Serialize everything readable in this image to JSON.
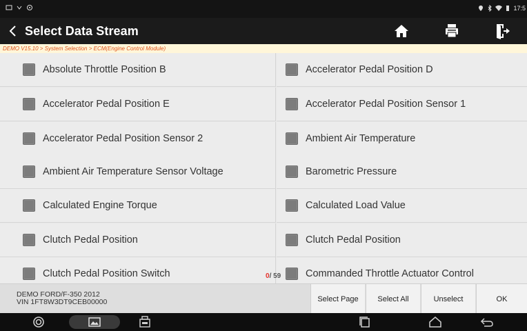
{
  "status_bar": {
    "time": "17:5"
  },
  "header": {
    "title": "Select Data Stream",
    "back_icon": "chevron-left-icon",
    "actions": [
      "home-icon",
      "printer-icon",
      "exit-icon"
    ]
  },
  "breadcrumb": "DEMO V15.10 > System Selection > ECM(Engine Control Module)",
  "items": [
    {
      "label": "Absolute Throttle Position B",
      "checked": false
    },
    {
      "label": "Accelerator Pedal Position D",
      "checked": false
    },
    {
      "label": "Accelerator Pedal Position E",
      "checked": false
    },
    {
      "label": "Accelerator Pedal Position Sensor 1",
      "checked": false
    },
    {
      "label": "Accelerator Pedal Position Sensor 2",
      "checked": false
    },
    {
      "label": "Ambient Air Temperature",
      "checked": false
    },
    {
      "label": "Ambient Air Temperature Sensor Voltage",
      "checked": false
    },
    {
      "label": "Barometric Pressure",
      "checked": false
    },
    {
      "label": "Calculated Engine Torque",
      "checked": false
    },
    {
      "label": "Calculated Load Value",
      "checked": false
    },
    {
      "label": "Clutch Pedal Position",
      "checked": false
    },
    {
      "label": "Clutch Pedal Position",
      "checked": false
    },
    {
      "label": "Clutch Pedal Position Switch",
      "checked": false
    },
    {
      "label": "Commanded Throttle Actuator Control",
      "checked": false
    }
  ],
  "counter": {
    "selected": "0",
    "total": "/ 59"
  },
  "footer": {
    "vehicle_line1": "DEMO FORD/F-350 2012",
    "vehicle_line2": "VIN 1FT8W3DT9CEB00000",
    "buttons": [
      "Select Page",
      "Select All",
      "Unselect",
      "OK"
    ]
  },
  "colors": {
    "title_bar": "#1b1b1b",
    "breadcrumb_text": "#e0551d",
    "breadcrumb_bg": "#fff6d9",
    "counter_selected": "#e5312b",
    "checkbox": "#7c7c7c"
  }
}
